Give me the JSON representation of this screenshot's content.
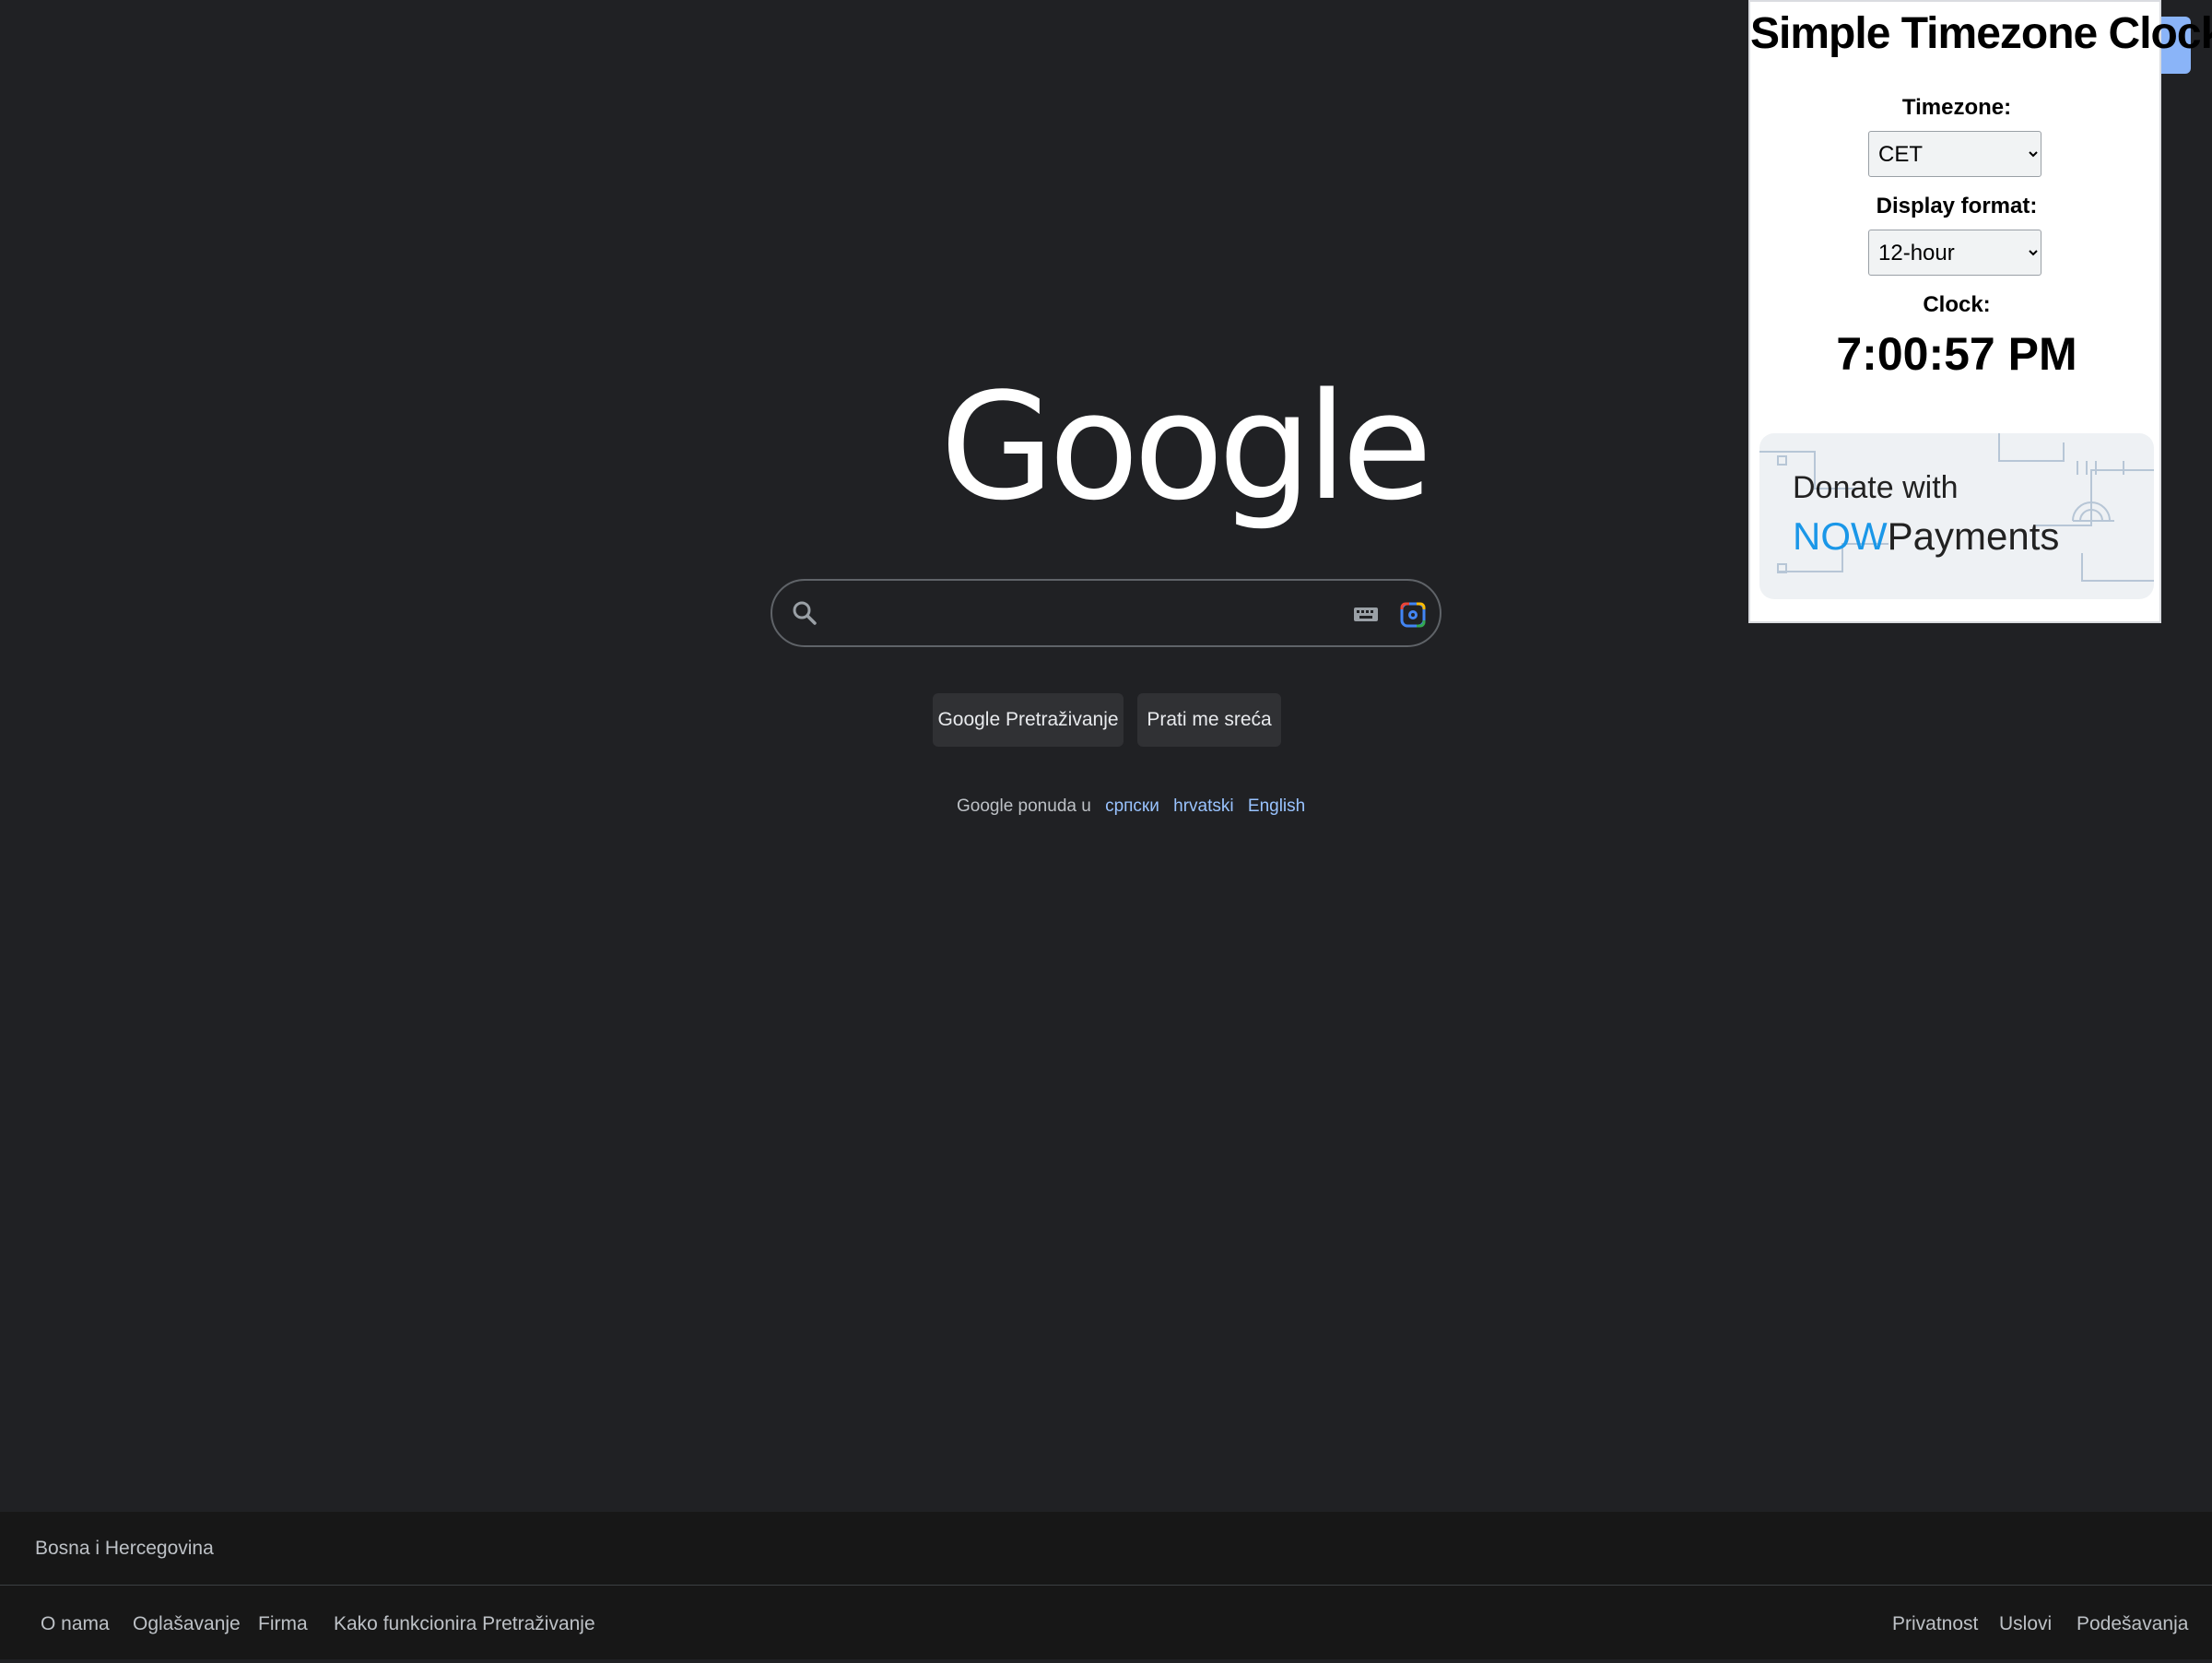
{
  "google": {
    "logo_text": "Google",
    "search_value": "",
    "search_button": "Google Pretraživanje",
    "lucky_button": "Prati me sreća",
    "offer_text": "Google ponuda u",
    "languages": [
      "српски",
      "hrvatski",
      "English"
    ]
  },
  "footer": {
    "country": "Bosna i Hercegovina",
    "left_links": [
      "O nama",
      "Oglašavanje",
      "Firma",
      "Kako funkcionira Pretraživanje"
    ],
    "right_links": [
      "Privatnost",
      "Uslovi",
      "Podešavanja"
    ]
  },
  "extension": {
    "title": "Simple Timezone Clock",
    "timezone_label": "Timezone:",
    "timezone_value": "CET",
    "format_label": "Display format:",
    "format_value": "12-hour",
    "clock_label": "Clock:",
    "clock_value": "7:00:57 PM",
    "donate_line1": "Donate with",
    "donate_brand_now": "NOW",
    "donate_brand_rest": "Payments"
  },
  "colors": {
    "background": "#202124",
    "footer": "#171717",
    "link": "#99c3ff",
    "now_blue": "#1a97e8"
  },
  "icons": [
    "search-icon",
    "keyboard-icon",
    "lens-camera-icon"
  ]
}
